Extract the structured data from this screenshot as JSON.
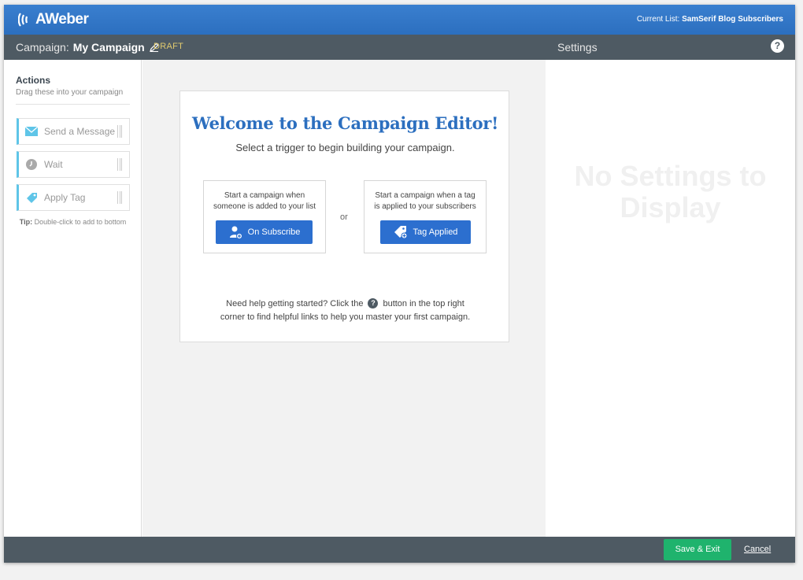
{
  "app": {
    "logo_text": "AWeber",
    "current_list_label": "Current List:",
    "current_list_value": "SamSerif Blog Subscribers"
  },
  "campaign_bar": {
    "label": "Campaign:",
    "name": "My Campaign",
    "status": "DRAFT",
    "settings_label": "Settings",
    "help_glyph": "?"
  },
  "sidebar": {
    "title": "Actions",
    "subtitle": "Drag these into your campaign",
    "items": [
      {
        "label": "Send a Message",
        "icon": "envelope-icon"
      },
      {
        "label": "Wait",
        "icon": "clock-icon"
      },
      {
        "label": "Apply Tag",
        "icon": "tag-icon"
      }
    ],
    "tip_bold": "Tip:",
    "tip_text": " Double-click to add to bottom"
  },
  "welcome": {
    "title": "Welcome to the Campaign Editor!",
    "subtitle": "Select a trigger to begin building your campaign.",
    "trigger_left_line1": "Start a campaign when",
    "trigger_left_line2": "someone is added to your list",
    "trigger_left_button": "On Subscribe",
    "or_text": "or",
    "trigger_right_line1": "Start a campaign when a tag",
    "trigger_right_line2": "is applied to your subscribers",
    "trigger_right_button": "Tag Applied",
    "help_part1": "Need help getting started? Click the",
    "help_part2": "button in the top right",
    "help_line2": "corner to find helpful links to help you master your first campaign."
  },
  "settings_panel": {
    "empty_line1": "No Settings to",
    "empty_line2": "Display"
  },
  "footer": {
    "save_label": "Save & Exit",
    "cancel_label": "Cancel"
  },
  "colors": {
    "brand_blue": "#2c6fbf",
    "dark_bar": "#4e5a63",
    "accent_cyan": "#5fc5e8",
    "save_green": "#1fb36d",
    "draft_yellow": "#e0c96e"
  }
}
